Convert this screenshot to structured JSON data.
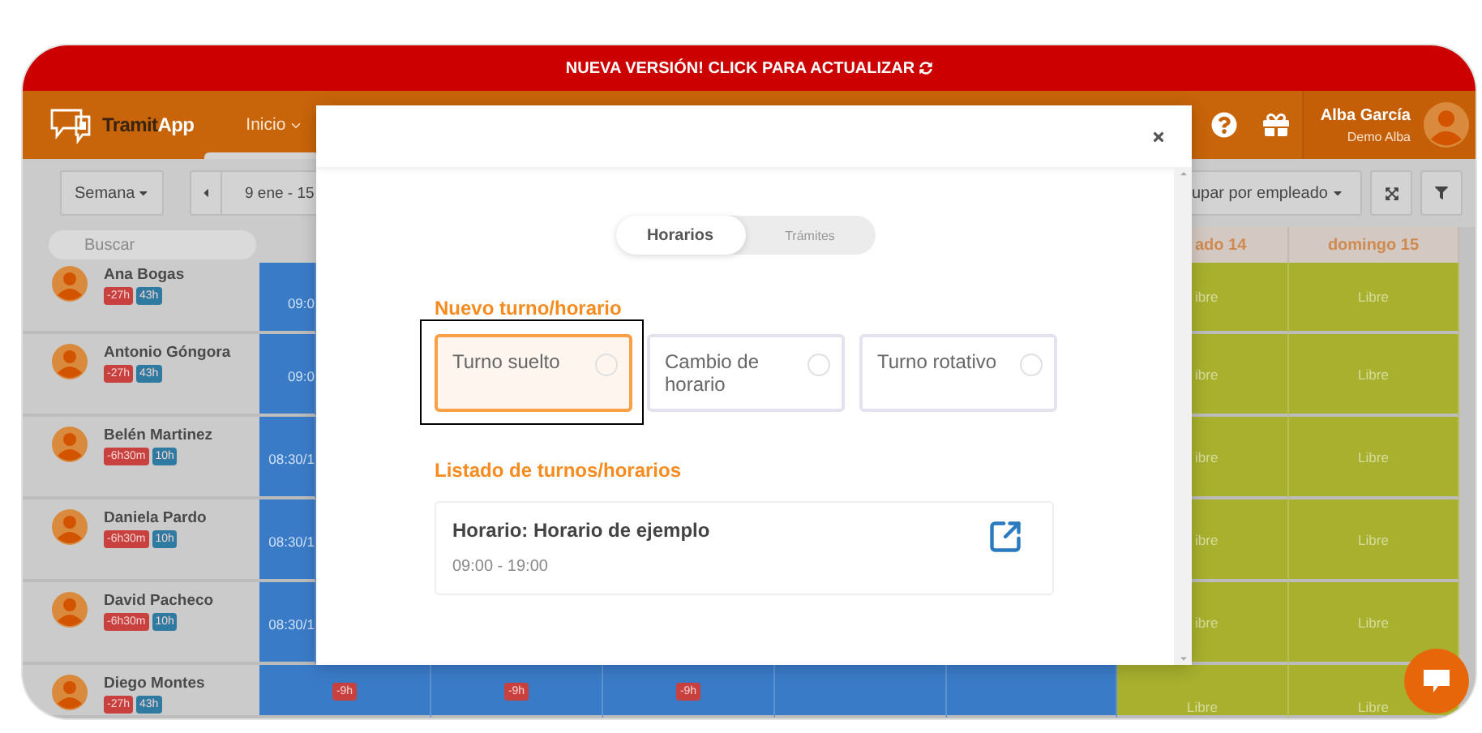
{
  "banner": {
    "text": "NUEVA VERSIÓN! CLICK PARA ACTUALIZAR"
  },
  "navbar": {
    "logo": [
      "Tramit",
      "App"
    ],
    "menu": [
      {
        "label": "Inicio",
        "selected": true
      }
    ],
    "user": {
      "name": "Alba García",
      "company": "Demo Alba"
    }
  },
  "toolbar": {
    "view": "Semana",
    "date_range": "9 ene - 15",
    "group_by": "upar por empleado"
  },
  "table": {
    "search": {
      "placeholder": "Buscar"
    },
    "day_headers": [
      "ado 14",
      "domingo 15"
    ],
    "rows": [
      {
        "name": "Ana Bogas",
        "badges": [
          {
            "text": "-27h",
            "kind": "balance"
          },
          {
            "text": "43h",
            "kind": "hours"
          }
        ],
        "cells": [
          {
            "kind": "shift",
            "text": "09:0"
          },
          {
            "kind": "free",
            "text": "ibre"
          },
          {
            "kind": "free",
            "text": "Libre"
          }
        ]
      },
      {
        "name": "Antonio Góngora",
        "badges": [
          {
            "text": "-27h",
            "kind": "balance"
          },
          {
            "text": "43h",
            "kind": "hours"
          }
        ],
        "cells": [
          {
            "kind": "shift",
            "text": "09:0"
          },
          {
            "kind": "free",
            "text": "ibre"
          },
          {
            "kind": "free",
            "text": "Libre"
          }
        ]
      },
      {
        "name": "Belén Martinez",
        "badges": [
          {
            "text": "-6h30m",
            "kind": "balance"
          },
          {
            "text": "10h",
            "kind": "hours"
          }
        ],
        "cells": [
          {
            "kind": "shift",
            "text": "08:30/1"
          },
          {
            "kind": "free",
            "text": "ibre"
          },
          {
            "kind": "free",
            "text": "Libre"
          }
        ]
      },
      {
        "name": "Daniela Pardo",
        "badges": [
          {
            "text": "-6h30m",
            "kind": "balance"
          },
          {
            "text": "10h",
            "kind": "hours"
          }
        ],
        "cells": [
          {
            "kind": "shift",
            "text": "08:30/1"
          },
          {
            "kind": "free",
            "text": "ibre"
          },
          {
            "kind": "free",
            "text": "Libre"
          }
        ]
      },
      {
        "name": "David Pacheco",
        "badges": [
          {
            "text": "-6h30m",
            "kind": "balance"
          },
          {
            "text": "10h",
            "kind": "hours"
          }
        ],
        "cells": [
          {
            "kind": "shift",
            "text": "08:30/1"
          },
          {
            "kind": "free",
            "text": "ibre"
          },
          {
            "kind": "free",
            "text": "Libre"
          }
        ]
      },
      {
        "name": "Diego Montes",
        "badges": [
          {
            "text": "-27h",
            "kind": "balance"
          },
          {
            "text": "43h",
            "kind": "hours"
          }
        ],
        "cells": [
          {
            "kind": "shift",
            "badge": "-9h"
          },
          {
            "kind": "shift",
            "badge": "-9h"
          },
          {
            "kind": "shift",
            "badge": "-9h"
          },
          {
            "kind": "shift"
          },
          {
            "kind": "shift"
          },
          {
            "kind": "free",
            "text": "Libre"
          },
          {
            "kind": "free",
            "text": "Libre"
          }
        ]
      }
    ]
  },
  "modal": {
    "tabs": [
      {
        "label": "Horarios",
        "selected": true
      },
      {
        "label": "Trámites",
        "selected": false
      }
    ],
    "new_title": "Nuevo turno/horario",
    "options": [
      {
        "label": "Turno suelto",
        "selected": true,
        "focused": true
      },
      {
        "label": "Cambio de horario",
        "selected": false,
        "focused": false
      },
      {
        "label": "Turno rotativo",
        "selected": false,
        "focused": false
      }
    ],
    "list_title": "Listado de turnos/horarios",
    "schedules": [
      {
        "title": "Horario: Horario de ejemplo",
        "hours": "09:00 - 19:00"
      }
    ]
  }
}
